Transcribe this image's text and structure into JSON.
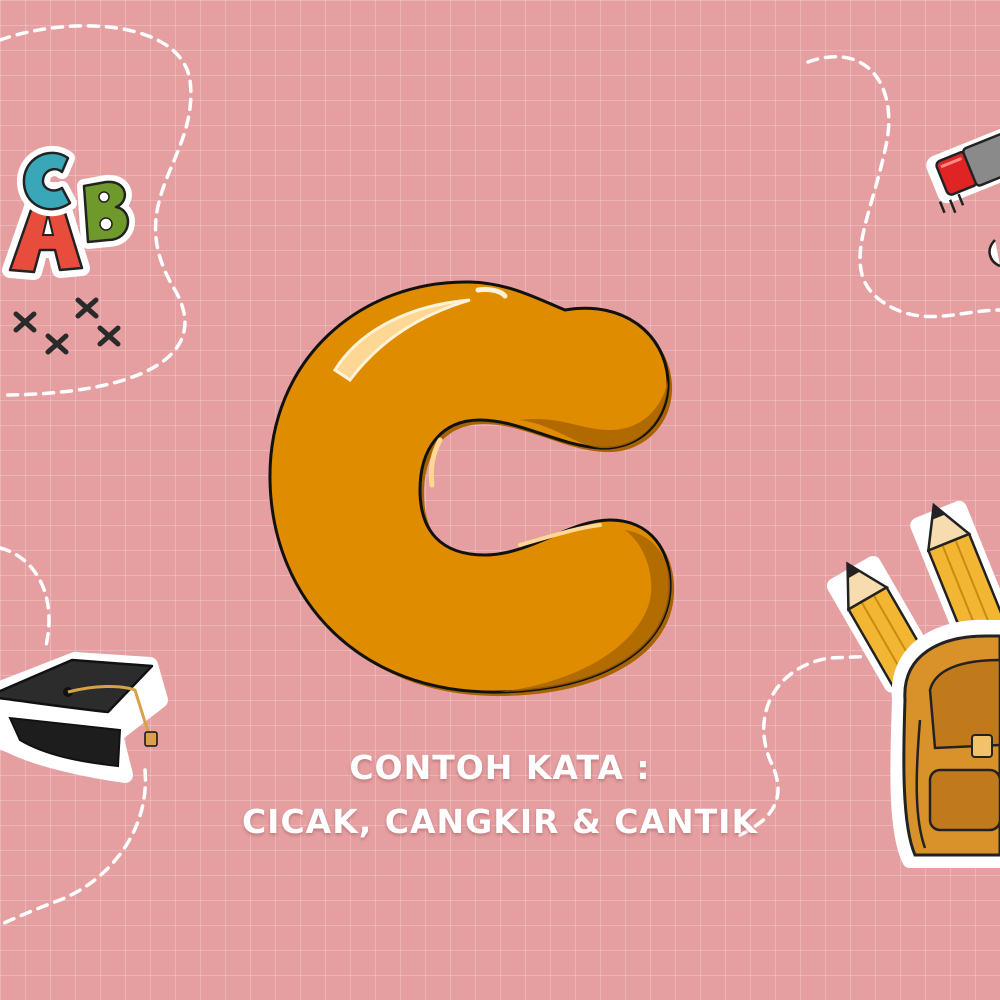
{
  "background": {
    "color": "#e59fa1",
    "grid": true
  },
  "letter": {
    "glyph": "C",
    "color": "#e08c00",
    "shade": "#a86400",
    "outline": "#111111"
  },
  "caption": {
    "line1": "CONTOH KATA :",
    "line2": "CICAK, CANGKIR & CANTIK"
  },
  "stickers": {
    "abc_blocks": {
      "letters": [
        "A",
        "C",
        "B"
      ],
      "colors": [
        "#e84c3d",
        "#3aa7b8",
        "#6f9a2b"
      ]
    },
    "icons": [
      "abc-letters-icon",
      "cross-stitches-icon",
      "marker-pen-icon",
      "graduation-cap-icon",
      "pencils-icon",
      "backpack-icon"
    ]
  }
}
